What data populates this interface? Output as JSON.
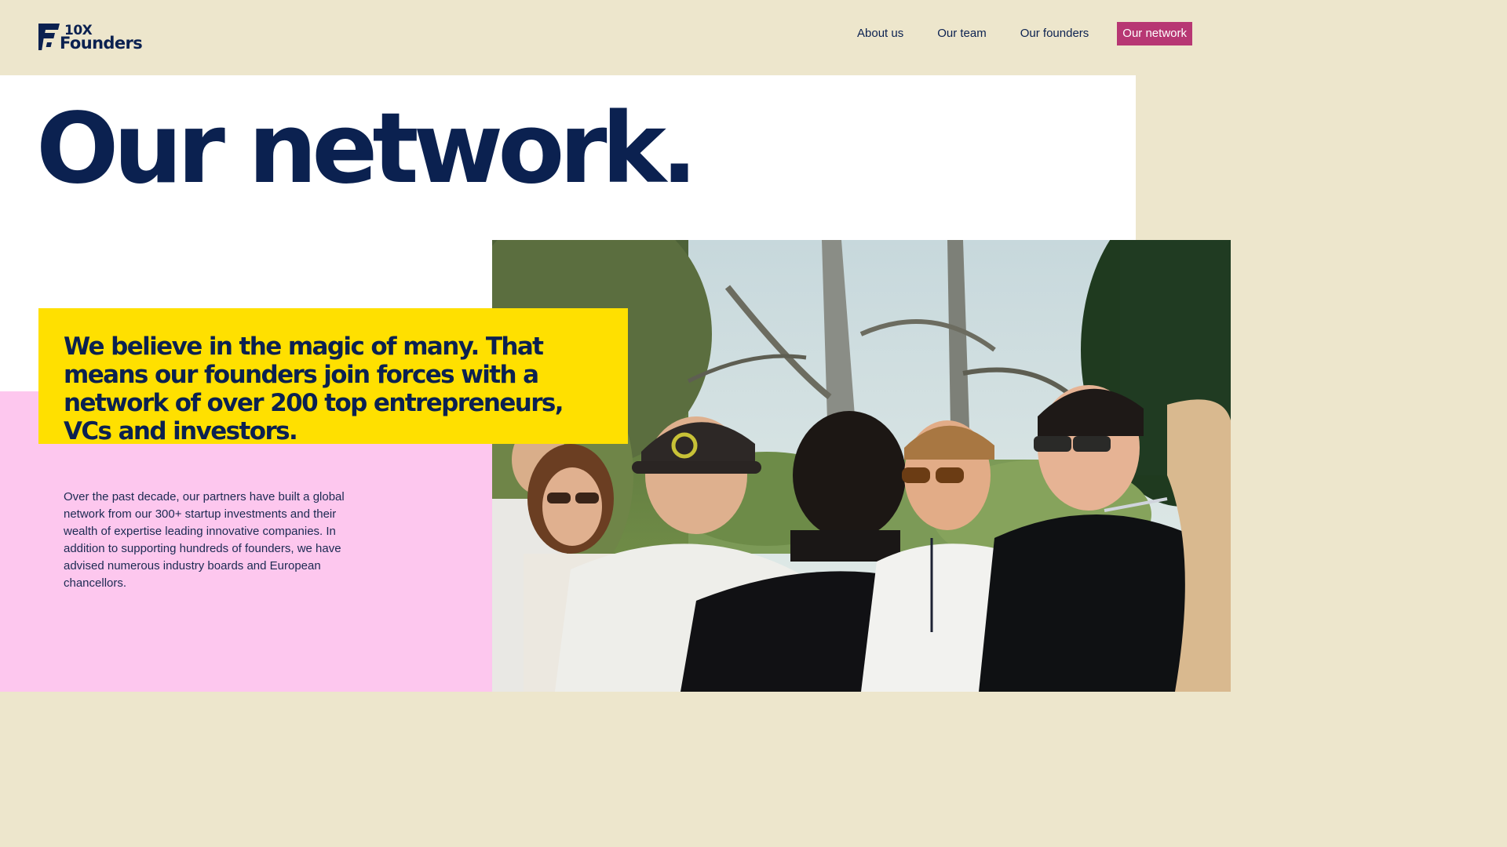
{
  "brand": {
    "logo_line1": "10X",
    "logo_line2": "Founders",
    "logo_icon": "10x-founders-logo-icon",
    "primary_color": "#0b2150"
  },
  "nav": {
    "items": [
      {
        "label": "About us",
        "active": false
      },
      {
        "label": "Our team",
        "active": false
      },
      {
        "label": "Our founders",
        "active": false
      },
      {
        "label": "Our network",
        "active": true
      }
    ],
    "active_color": "#b73773"
  },
  "hero": {
    "title": "Our network."
  },
  "quote": {
    "text": "We believe in the magic of many. That means our founders join forces with a network of over 200 top entrepreneurs, VCs and investors.",
    "background": "#ffe000"
  },
  "body": {
    "paragraph": "Over the past decade, our partners have built a global network from our 300+ startup investments and their wealth of expertise leading innovative companies. In addition to supporting hundreds of founders, we have advised numerous industry boards and European chancellors."
  },
  "colors": {
    "header_bg": "#ede6cc",
    "pink_panel": "#fdc7ee",
    "white_panel": "#ffffff"
  }
}
